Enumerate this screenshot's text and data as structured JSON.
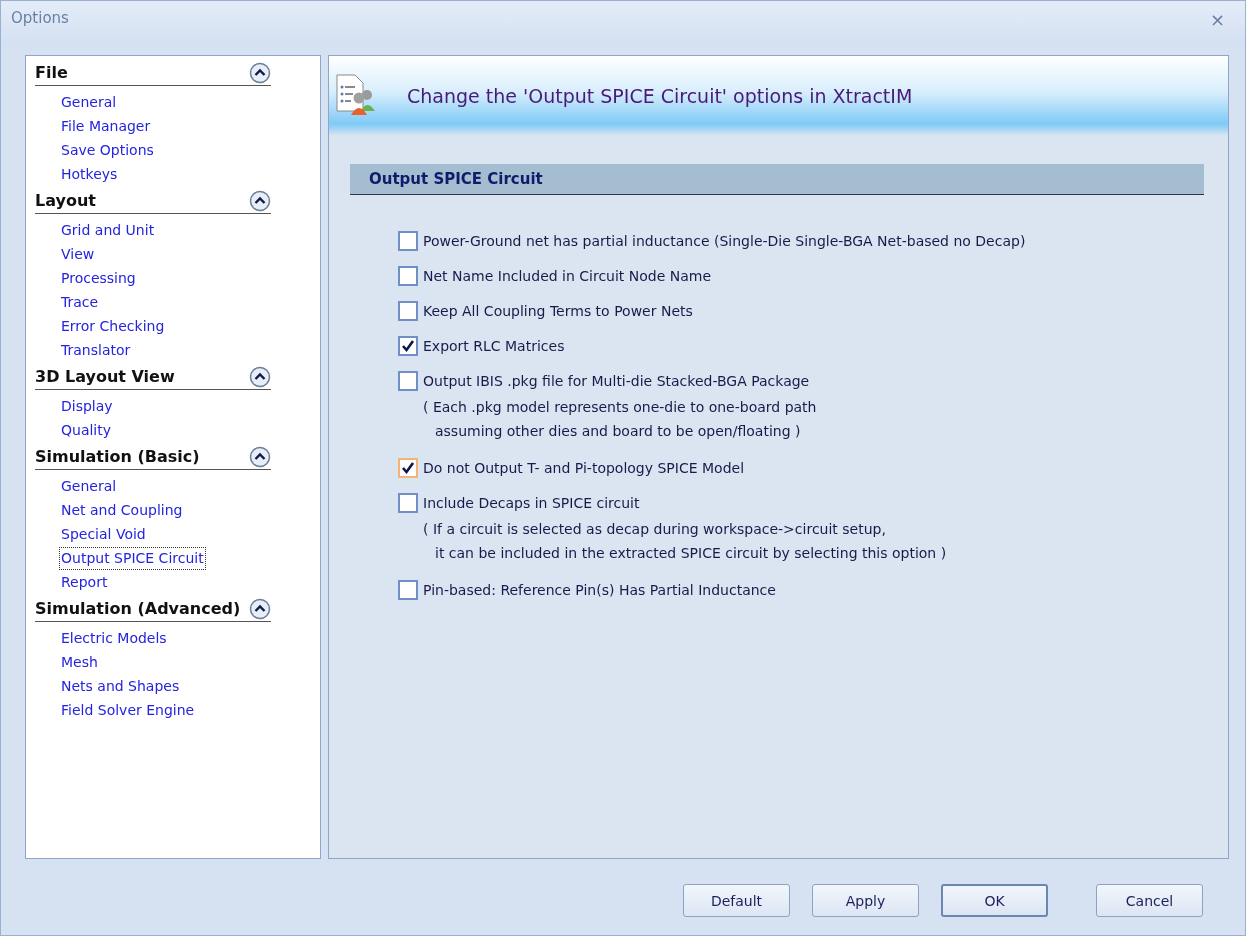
{
  "window": {
    "title": "Options",
    "close": "×"
  },
  "sidebar": {
    "groups": [
      {
        "title": "File",
        "expanded": true,
        "items": [
          {
            "label": "General",
            "selected": false
          },
          {
            "label": "File Manager",
            "selected": false
          },
          {
            "label": "Save Options",
            "selected": false
          },
          {
            "label": "Hotkeys",
            "selected": false
          }
        ]
      },
      {
        "title": "Layout",
        "expanded": true,
        "items": [
          {
            "label": "Grid and Unit",
            "selected": false
          },
          {
            "label": "View",
            "selected": false
          },
          {
            "label": "Processing",
            "selected": false
          },
          {
            "label": "Trace",
            "selected": false
          },
          {
            "label": "Error Checking",
            "selected": false
          },
          {
            "label": "Translator",
            "selected": false
          }
        ]
      },
      {
        "title": "3D Layout View",
        "expanded": true,
        "items": [
          {
            "label": "Display",
            "selected": false
          },
          {
            "label": "Quality",
            "selected": false
          }
        ]
      },
      {
        "title": "Simulation (Basic)",
        "expanded": true,
        "items": [
          {
            "label": "General",
            "selected": false
          },
          {
            "label": "Net and Coupling",
            "selected": false
          },
          {
            "label": "Special Void",
            "selected": false
          },
          {
            "label": "Output SPICE Circuit",
            "selected": true
          },
          {
            "label": "Report",
            "selected": false
          }
        ]
      },
      {
        "title": "Simulation (Advanced)",
        "expanded": true,
        "items": [
          {
            "label": "Electric Models",
            "selected": false
          },
          {
            "label": "Mesh",
            "selected": false
          },
          {
            "label": "Nets and Shapes",
            "selected": false
          },
          {
            "label": "Field Solver Engine",
            "selected": false
          }
        ]
      }
    ]
  },
  "banner": {
    "title": "Change the 'Output SPICE Circuit' options in XtractIM"
  },
  "section": {
    "title": "Output SPICE Circuit"
  },
  "options": [
    {
      "label": "Power-Ground net has partial inductance (Single-Die Single-BGA Net-based no Decap)",
      "checked": false,
      "color": "#6f8fc6"
    },
    {
      "label": "Net Name Included in Circuit Node Name",
      "checked": false,
      "color": "#6f8fc6"
    },
    {
      "label": "Keep All Coupling Terms to Power Nets",
      "checked": false,
      "color": "#6f8fc6"
    },
    {
      "label": "Export RLC Matrices",
      "checked": true,
      "color": "#6f8fc6"
    },
    {
      "label": "Output IBIS .pkg file for Multi-die Stacked-BGA Package",
      "checked": false,
      "color": "#6f8fc6",
      "note": [
        "( Each .pkg model represents one-die to one-board path",
        "assuming other dies and board to be open/floating )"
      ]
    },
    {
      "label": "Do not Output T- and Pi-topology SPICE Model",
      "checked": true,
      "color": "#f0b678"
    },
    {
      "label": "Include Decaps in SPICE circuit",
      "checked": false,
      "color": "#6f8fc6",
      "note": [
        "( If a circuit is selected as decap during workspace->circuit setup,",
        "it can be included in the extracted SPICE circuit by selecting this option )"
      ]
    },
    {
      "label": "Pin-based: Reference Pin(s) Has Partial Inductance",
      "checked": false,
      "color": "#6f8fc6"
    }
  ],
  "buttons": [
    {
      "label": "Default",
      "default": false
    },
    {
      "label": "Apply",
      "default": false
    },
    {
      "label": "OK",
      "default": true
    },
    {
      "label": "Cancel",
      "default": false
    }
  ]
}
